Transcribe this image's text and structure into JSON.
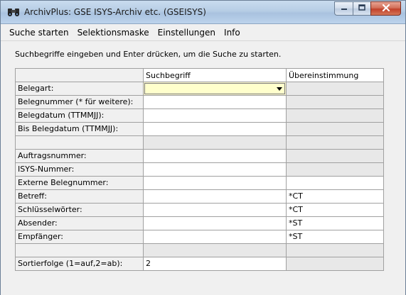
{
  "window": {
    "title": "ArchivPlus: GSE ISYS-Archiv etc. (GSEISYS)"
  },
  "menubar": {
    "items": [
      {
        "label": "Suche starten"
      },
      {
        "label": "Selektionsmaske"
      },
      {
        "label": "Einstellungen"
      },
      {
        "label": "Info"
      }
    ]
  },
  "instruction": "Suchbegriffe eingeben und Enter drücken, um die Suche zu starten.",
  "grid": {
    "headers": {
      "col1": "",
      "col2": "Suchbegriff",
      "col3": "Übereinstimmung"
    },
    "rows": [
      {
        "label": "Belegart:",
        "value": "",
        "match": ""
      },
      {
        "label": "Belegnummer (* für weitere):",
        "value": "",
        "match": ""
      },
      {
        "label": "Belegdatum (TTMMJJ):",
        "value": "",
        "match": ""
      },
      {
        "label": "Bis Belegdatum (TTMMJJ):",
        "value": "",
        "match": ""
      },
      {
        "label": "",
        "value": "",
        "match": ""
      },
      {
        "label": "Auftragsnummer:",
        "value": "",
        "match": ""
      },
      {
        "label": "ISYS-Nummer:",
        "value": "",
        "match": ""
      },
      {
        "label": "Externe Belegnummer:",
        "value": "",
        "match": ""
      },
      {
        "label": "Betreff:",
        "value": "",
        "match": "*CT"
      },
      {
        "label": "Schlüsselwörter:",
        "value": "",
        "match": "*CT"
      },
      {
        "label": "Absender:",
        "value": "",
        "match": "*ST"
      },
      {
        "label": "Empfänger:",
        "value": "",
        "match": "*ST"
      },
      {
        "label": "",
        "value": "",
        "match": ""
      },
      {
        "label": "Sortierfolge (1=auf,2=ab):",
        "value": "2",
        "match": ""
      }
    ]
  },
  "icons": {
    "app": "binoculars-icon",
    "minimize": "minimize-icon",
    "maximize": "maximize-icon",
    "close": "close-icon",
    "dropdown": "chevron-down-icon"
  },
  "colors": {
    "selected_field": "#ffffcc",
    "close_button": "#c7432c"
  }
}
